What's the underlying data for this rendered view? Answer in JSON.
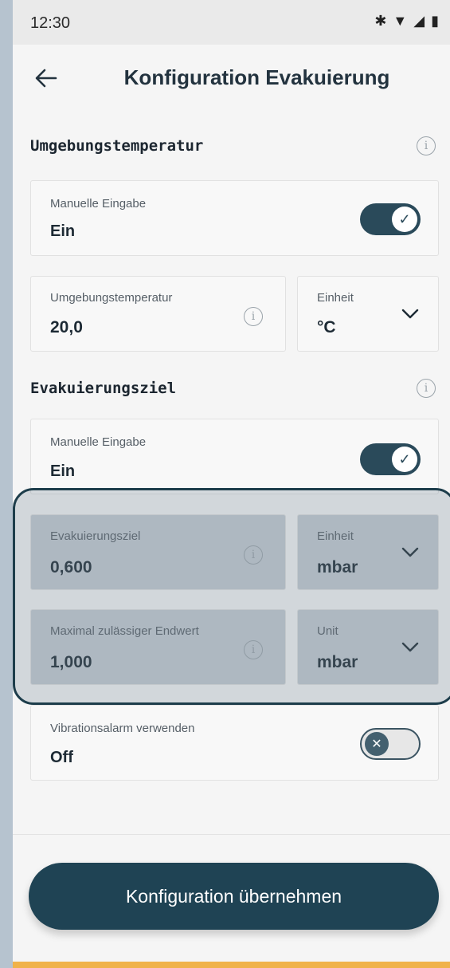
{
  "status": {
    "time": "12:30"
  },
  "header": {
    "title": "Konfiguration Evakuierung"
  },
  "section_temp": {
    "title": "Umgebungstemperatur",
    "manual_label": "Manuelle Eingabe",
    "manual_value": "Ein",
    "manual_on": true,
    "field_label": "Umgebungstemperatur",
    "field_value": "20,0",
    "unit_label": "Einheit",
    "unit_value": "°C"
  },
  "section_target": {
    "title": "Evakuierungsziel",
    "manual_label": "Manuelle Eingabe",
    "manual_value": "Ein",
    "manual_on": true,
    "field_label": "Evakuierungsziel",
    "field_value": "0,600",
    "unit_label": "Einheit",
    "unit_value": "mbar",
    "max_label": "Maximal zulässiger Endwert",
    "max_value": "1,000",
    "max_unit_label": "Unit",
    "max_unit_value": "mbar"
  },
  "vibration": {
    "label": "Vibrationsalarm verwenden",
    "value": "Off",
    "on": false
  },
  "cta": {
    "label": "Konfiguration übernehmen"
  },
  "colors": {
    "primary": "#1f4354",
    "accent_bottom": "#f0b24a"
  }
}
